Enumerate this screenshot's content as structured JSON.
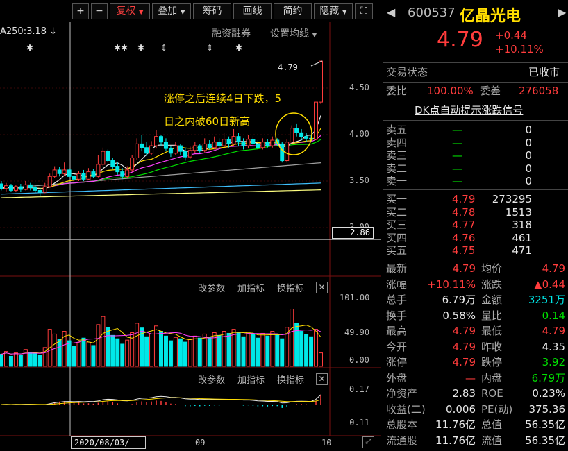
{
  "toolbar": {
    "plus": "+",
    "minus": "−",
    "fuquan": "复权",
    "overlay": "叠加",
    "chips": "筹码",
    "draw": "画线",
    "simple": "简约",
    "hide": "隐藏",
    "fullscreen": "⛶"
  },
  "main_chart": {
    "ma_label": "A250:3.18 ↓",
    "finance_label": "融资融券",
    "set_ma_label": "设置均线",
    "price_ticks": [
      "4.50",
      "4.00",
      "3.50",
      "3.00"
    ],
    "current_price_box": "2.86",
    "last_price_label": "4.79",
    "annotation_line1": "涨停之后连续4日下跌，5",
    "annotation_line2": "日之内破60日新高",
    "markers": [
      "✱",
      "✱✱",
      "✱",
      "⇕",
      "⇕",
      "✱"
    ],
    "ohlc": [
      [
        3.47,
        3.42,
        3.5,
        3.4
      ],
      [
        3.42,
        3.45,
        3.48,
        3.39
      ],
      [
        3.45,
        3.4,
        3.47,
        3.38
      ],
      [
        3.4,
        3.44,
        3.46,
        3.38
      ],
      [
        3.44,
        3.41,
        3.47,
        3.38
      ],
      [
        3.41,
        3.46,
        3.5,
        3.4
      ],
      [
        3.46,
        3.43,
        3.48,
        3.4
      ],
      [
        3.43,
        3.4,
        3.46,
        3.37
      ],
      [
        3.4,
        3.38,
        3.43,
        3.34
      ],
      [
        3.38,
        3.44,
        3.48,
        3.37
      ],
      [
        3.44,
        3.55,
        3.58,
        3.43
      ],
      [
        3.55,
        3.62,
        3.66,
        3.53
      ],
      [
        3.62,
        3.58,
        3.65,
        3.55
      ],
      [
        3.58,
        3.62,
        3.7,
        3.56
      ],
      [
        3.62,
        3.55,
        3.64,
        3.53
      ],
      [
        3.55,
        3.52,
        3.58,
        3.5
      ],
      [
        3.52,
        3.58,
        3.61,
        3.5
      ],
      [
        3.58,
        3.52,
        3.62,
        3.5
      ],
      [
        3.52,
        3.6,
        3.64,
        3.51
      ],
      [
        3.6,
        3.55,
        3.63,
        3.53
      ],
      [
        3.55,
        3.68,
        3.78,
        3.54
      ],
      [
        3.68,
        3.82,
        3.86,
        3.66
      ],
      [
        3.82,
        3.72,
        3.84,
        3.7
      ],
      [
        3.72,
        3.66,
        3.75,
        3.63
      ],
      [
        3.66,
        3.6,
        3.7,
        3.57
      ],
      [
        3.6,
        3.55,
        3.64,
        3.52
      ],
      [
        3.55,
        3.62,
        3.66,
        3.53
      ],
      [
        3.62,
        3.75,
        3.78,
        3.6
      ],
      [
        3.75,
        3.9,
        3.96,
        3.73
      ],
      [
        3.9,
        3.86,
        4.0,
        3.82
      ],
      [
        3.86,
        3.8,
        3.92,
        3.77
      ],
      [
        3.8,
        3.88,
        3.93,
        3.78
      ],
      [
        3.88,
        3.98,
        4.05,
        3.85
      ],
      [
        3.98,
        3.92,
        4.0,
        3.88
      ],
      [
        3.92,
        3.85,
        3.96,
        3.82
      ],
      [
        3.85,
        3.8,
        3.88,
        3.76
      ],
      [
        3.8,
        3.88,
        3.92,
        3.78
      ],
      [
        3.88,
        3.82,
        3.9,
        3.78
      ],
      [
        3.82,
        3.76,
        3.86,
        3.72
      ],
      [
        3.76,
        3.83,
        3.87,
        3.74
      ],
      [
        3.83,
        3.88,
        3.92,
        3.8
      ],
      [
        3.88,
        3.83,
        3.9,
        3.8
      ],
      [
        3.83,
        3.9,
        3.96,
        3.81
      ],
      [
        3.9,
        3.86,
        3.94,
        3.84
      ],
      [
        3.86,
        3.92,
        3.98,
        3.84
      ],
      [
        3.92,
        3.88,
        3.96,
        3.86
      ],
      [
        3.88,
        3.95,
        4.02,
        3.86
      ],
      [
        3.95,
        3.9,
        3.98,
        3.86
      ],
      [
        3.9,
        3.98,
        4.06,
        3.88
      ],
      [
        3.98,
        3.92,
        4.02,
        3.88
      ],
      [
        3.92,
        3.88,
        3.96,
        3.84
      ],
      [
        3.88,
        3.95,
        4.0,
        3.85
      ],
      [
        3.95,
        3.9,
        3.98,
        3.88
      ],
      [
        3.9,
        3.86,
        3.94,
        3.84
      ],
      [
        3.86,
        3.92,
        3.96,
        3.84
      ],
      [
        3.92,
        3.88,
        3.95,
        3.86
      ],
      [
        3.88,
        3.94,
        3.98,
        3.86
      ],
      [
        3.94,
        3.9,
        3.96,
        3.88
      ],
      [
        3.9,
        3.72,
        3.92,
        3.7
      ],
      [
        3.72,
        3.92,
        3.95,
        3.7
      ],
      [
        3.92,
        4.07,
        4.1,
        3.9
      ],
      [
        4.07,
        4.02,
        4.12,
        3.98
      ],
      [
        4.02,
        3.98,
        4.06,
        3.94
      ],
      [
        3.98,
        3.96,
        4.02,
        3.92
      ],
      [
        3.96,
        3.95,
        4.0,
        3.92
      ],
      [
        3.95,
        4.35,
        4.35,
        3.94
      ],
      [
        4.35,
        4.79,
        4.79,
        4.33
      ]
    ]
  },
  "volume_chart": {
    "buttons": [
      "改参数",
      "加指标",
      "换指标"
    ],
    "ticks": [
      "101.00",
      "49.90",
      "0.00"
    ],
    "values": [
      18,
      22,
      15,
      20,
      17,
      25,
      21,
      19,
      16,
      28,
      55,
      48,
      40,
      52,
      38,
      30,
      35,
      42,
      36,
      31,
      62,
      74,
      58,
      46,
      41,
      33,
      39,
      50,
      64,
      57,
      44,
      48,
      60,
      52,
      45,
      38,
      43,
      41,
      36,
      40,
      45,
      42,
      48,
      43,
      50,
      46,
      52,
      49,
      55,
      50,
      44,
      51,
      47,
      42,
      49,
      45,
      52,
      48,
      41,
      58,
      85,
      64,
      52,
      47,
      44,
      55,
      20
    ]
  },
  "macd_chart": {
    "buttons": [
      "改参数",
      "加指标",
      "换指标"
    ],
    "ticks": [
      "0.17",
      "-0.11"
    ],
    "date_box": "2020/08/03/—",
    "month_labels": [
      "09",
      "10"
    ]
  },
  "quote": {
    "code": "600537",
    "name": "亿晶光电",
    "price": "4.79",
    "change": "+0.44",
    "change_pct": "+10.11%",
    "trade_status_label": "交易状态",
    "trade_status": "已收市",
    "weibi_label": "委比",
    "weibi": "100.00%",
    "weicha_label": "委差",
    "weicha": "276058",
    "signal_link": "DK点自动提示涨跌信号",
    "sell": [
      {
        "label": "卖五",
        "price": "—",
        "vol": "0"
      },
      {
        "label": "卖四",
        "price": "—",
        "vol": "0"
      },
      {
        "label": "卖三",
        "price": "—",
        "vol": "0"
      },
      {
        "label": "卖二",
        "price": "—",
        "vol": "0"
      },
      {
        "label": "卖一",
        "price": "—",
        "vol": "0"
      }
    ],
    "buy": [
      {
        "label": "买一",
        "price": "4.79",
        "vol": "273295"
      },
      {
        "label": "买二",
        "price": "4.78",
        "vol": "1513"
      },
      {
        "label": "买三",
        "price": "4.77",
        "vol": "318"
      },
      {
        "label": "买四",
        "price": "4.76",
        "vol": "461"
      },
      {
        "label": "买五",
        "price": "4.75",
        "vol": "471"
      }
    ],
    "stats": [
      {
        "l1": "最新",
        "v1": "4.79",
        "c1": "red",
        "l2": "均价",
        "v2": "4.79",
        "c2": "red"
      },
      {
        "l1": "涨幅",
        "v1": "+10.11%",
        "c1": "red",
        "l2": "涨跌",
        "v2": "▲0.44",
        "c2": "red"
      },
      {
        "l1": "总手",
        "v1": "6.79万",
        "c1": "white",
        "l2": "金额",
        "v2": "3251万",
        "c2": "cyan"
      },
      {
        "l1": "换手",
        "v1": "0.58%",
        "c1": "white",
        "l2": "量比",
        "v2": "0.14",
        "c2": "green"
      },
      {
        "l1": "最高",
        "v1": "4.79",
        "c1": "red",
        "l2": "最低",
        "v2": "4.79",
        "c2": "red"
      },
      {
        "l1": "今开",
        "v1": "4.79",
        "c1": "red",
        "l2": "昨收",
        "v2": "4.35",
        "c2": "white"
      },
      {
        "l1": "涨停",
        "v1": "4.79",
        "c1": "red",
        "l2": "跌停",
        "v2": "3.92",
        "c2": "green"
      },
      {
        "l1": "外盘",
        "v1": "—",
        "c1": "red",
        "l2": "内盘",
        "v2": "6.79万",
        "c2": "green"
      },
      {
        "l1": "净资产",
        "v1": "2.83",
        "c1": "white",
        "l2": "ROE",
        "v2": "0.23%",
        "c2": "white"
      },
      {
        "l1": "收益(二)",
        "v1": "0.006",
        "c1": "white",
        "l2": "PE(动)",
        "v2": "375.36",
        "c2": "white"
      },
      {
        "l1": "总股本",
        "v1": "11.76亿",
        "c1": "white",
        "l2": "总值",
        "v2": "56.35亿",
        "c2": "white"
      },
      {
        "l1": "流通股",
        "v1": "11.76亿",
        "c1": "white",
        "l2": "流值",
        "v2": "56.35亿",
        "c2": "white"
      }
    ]
  },
  "colors": {
    "up": "#ff3c3c",
    "down": "#00e8e8",
    "ma5": "#e8e8e8",
    "ma10": "#ffdd00",
    "ma20": "#ff40ff",
    "ma30": "#00e000",
    "ma60": "#a0a0a0",
    "ma120": "#40c0ff",
    "ma250": "#ffff80"
  }
}
